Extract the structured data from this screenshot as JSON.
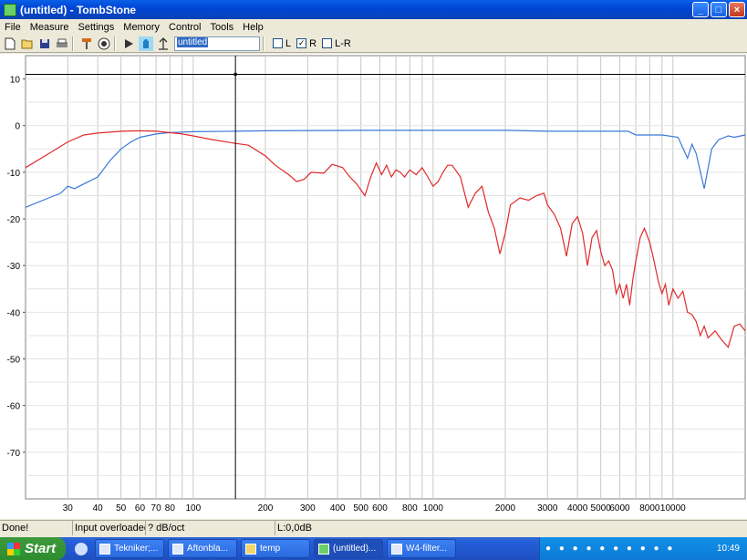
{
  "window": {
    "title": "(untitled) - TombStone"
  },
  "menu": [
    "File",
    "Measure",
    "Settings",
    "Memory",
    "Control",
    "Tools",
    "Help"
  ],
  "toolbar": {
    "name_value": "untitled",
    "checkboxes": [
      {
        "label": "L",
        "checked": false
      },
      {
        "label": "R",
        "checked": true
      },
      {
        "label": "L-R",
        "checked": false
      }
    ]
  },
  "chart_data": {
    "type": "line",
    "x_scale": "log",
    "xlim": [
      20,
      20000
    ],
    "ylim": [
      -80,
      15
    ],
    "x_ticks": [
      {
        "value": 30,
        "label": "30"
      },
      {
        "value": 40,
        "label": "40"
      },
      {
        "value": 50,
        "label": "50"
      },
      {
        "value": 60,
        "label": "60"
      },
      {
        "value": 70,
        "label": "70"
      },
      {
        "value": 80,
        "label": "80"
      },
      {
        "value": 100,
        "label": "100"
      },
      {
        "value": 200,
        "label": "200"
      },
      {
        "value": 300,
        "label": "300"
      },
      {
        "value": 400,
        "label": "400"
      },
      {
        "value": 500,
        "label": "500"
      },
      {
        "value": 600,
        "label": "600"
      },
      {
        "value": 800,
        "label": "800"
      },
      {
        "value": 1000,
        "label": "1000"
      },
      {
        "value": 2000,
        "label": "2000"
      },
      {
        "value": 3000,
        "label": "3000"
      },
      {
        "value": 4000,
        "label": "4000"
      },
      {
        "value": 5000,
        "label": "5000"
      },
      {
        "value": 6000,
        "label": "6000"
      },
      {
        "value": 8000,
        "label": "8000"
      },
      {
        "value": 10000,
        "label": "10000"
      }
    ],
    "y_ticks": [
      10,
      0,
      -10,
      -20,
      -30,
      -40,
      -50,
      -60,
      -70
    ],
    "grid": true,
    "cursor": {
      "x": 150,
      "y": 11
    },
    "series": [
      {
        "color": "#3a78d8",
        "points": [
          [
            20,
            -17.5
          ],
          [
            25,
            -15.5
          ],
          [
            28,
            -14.5
          ],
          [
            30,
            -13
          ],
          [
            32,
            -13.5
          ],
          [
            35,
            -12.5
          ],
          [
            40,
            -11
          ],
          [
            45,
            -7.5
          ],
          [
            50,
            -5
          ],
          [
            55,
            -3.5
          ],
          [
            60,
            -2.5
          ],
          [
            70,
            -1.8
          ],
          [
            80,
            -1.5
          ],
          [
            90,
            -1.4
          ],
          [
            100,
            -1.3
          ],
          [
            150,
            -1.2
          ],
          [
            200,
            -1.1
          ],
          [
            500,
            -1
          ],
          [
            1000,
            -1
          ],
          [
            2000,
            -1
          ],
          [
            3000,
            -1.2
          ],
          [
            5000,
            -1.2
          ],
          [
            6500,
            -1.2
          ],
          [
            7000,
            -2
          ],
          [
            9000,
            -2
          ],
          [
            10500,
            -2.5
          ],
          [
            11500,
            -7
          ],
          [
            12000,
            -4
          ],
          [
            12500,
            -6
          ],
          [
            13500,
            -13.5
          ],
          [
            14500,
            -5
          ],
          [
            15500,
            -3
          ],
          [
            17000,
            -2.2
          ],
          [
            18000,
            -2.5
          ],
          [
            20000,
            -2
          ]
        ]
      },
      {
        "color": "#e02a2a",
        "points": [
          [
            20,
            -9
          ],
          [
            25,
            -6
          ],
          [
            30,
            -3.5
          ],
          [
            35,
            -2
          ],
          [
            40,
            -1.6
          ],
          [
            50,
            -1.2
          ],
          [
            60,
            -1.1
          ],
          [
            70,
            -1.2
          ],
          [
            80,
            -1.5
          ],
          [
            90,
            -1.8
          ],
          [
            100,
            -2.2
          ],
          [
            120,
            -3
          ],
          [
            150,
            -3.8
          ],
          [
            170,
            -4.2
          ],
          [
            200,
            -6.5
          ],
          [
            220,
            -8.5
          ],
          [
            250,
            -10.5
          ],
          [
            270,
            -12
          ],
          [
            290,
            -11.5
          ],
          [
            310,
            -10
          ],
          [
            350,
            -10.2
          ],
          [
            380,
            -8.3
          ],
          [
            420,
            -9
          ],
          [
            450,
            -11
          ],
          [
            480,
            -12.5
          ],
          [
            520,
            -15
          ],
          [
            550,
            -11
          ],
          [
            580,
            -8
          ],
          [
            610,
            -10.5
          ],
          [
            640,
            -8.5
          ],
          [
            670,
            -11
          ],
          [
            700,
            -9.5
          ],
          [
            730,
            -10
          ],
          [
            760,
            -11
          ],
          [
            800,
            -9.5
          ],
          [
            850,
            -10.5
          ],
          [
            900,
            -9
          ],
          [
            950,
            -11
          ],
          [
            1000,
            -13
          ],
          [
            1050,
            -12
          ],
          [
            1100,
            -10
          ],
          [
            1150,
            -8.5
          ],
          [
            1200,
            -8.5
          ],
          [
            1300,
            -11
          ],
          [
            1400,
            -17.5
          ],
          [
            1500,
            -14.5
          ],
          [
            1600,
            -13
          ],
          [
            1700,
            -18.5
          ],
          [
            1800,
            -22
          ],
          [
            1900,
            -27.5
          ],
          [
            2000,
            -23
          ],
          [
            2100,
            -17
          ],
          [
            2300,
            -15.5
          ],
          [
            2500,
            -16
          ],
          [
            2700,
            -15
          ],
          [
            2900,
            -14.5
          ],
          [
            3000,
            -17
          ],
          [
            3200,
            -19
          ],
          [
            3400,
            -22
          ],
          [
            3600,
            -28
          ],
          [
            3800,
            -21
          ],
          [
            4000,
            -19.5
          ],
          [
            4200,
            -23
          ],
          [
            4400,
            -30
          ],
          [
            4600,
            -24
          ],
          [
            4800,
            -22.5
          ],
          [
            5000,
            -27
          ],
          [
            5200,
            -30
          ],
          [
            5400,
            -29
          ],
          [
            5600,
            -31
          ],
          [
            5800,
            -36
          ],
          [
            6000,
            -34
          ],
          [
            6200,
            -37
          ],
          [
            6400,
            -34
          ],
          [
            6600,
            -38.5
          ],
          [
            6800,
            -33
          ],
          [
            7000,
            -29
          ],
          [
            7300,
            -24
          ],
          [
            7600,
            -22
          ],
          [
            8000,
            -25
          ],
          [
            8300,
            -28.5
          ],
          [
            8700,
            -33.5
          ],
          [
            9000,
            -36
          ],
          [
            9300,
            -34
          ],
          [
            9600,
            -38.5
          ],
          [
            10000,
            -35
          ],
          [
            10500,
            -37
          ],
          [
            11000,
            -35.5
          ],
          [
            11500,
            -40
          ],
          [
            12000,
            -40.5
          ],
          [
            12500,
            -42
          ],
          [
            13000,
            -45
          ],
          [
            13500,
            -43
          ],
          [
            14000,
            -45.5
          ],
          [
            15000,
            -44
          ],
          [
            16000,
            -46
          ],
          [
            17000,
            -47.5
          ],
          [
            18000,
            -43
          ],
          [
            19000,
            -42.5
          ],
          [
            20000,
            -44
          ]
        ]
      }
    ]
  },
  "statusbar": {
    "message": "Done!",
    "warning": "Input overloaded!",
    "smoothing": "? dB/oct",
    "level": "L:0,0dB"
  },
  "taskbar": {
    "start_label": "Start",
    "tasks": [
      {
        "label": "Tekniker;...",
        "active": false
      },
      {
        "label": "Aftonbla...",
        "active": false
      },
      {
        "label": "temp",
        "active": false
      },
      {
        "label": "(untitled)...",
        "active": true
      },
      {
        "label": "W4-filter...",
        "active": false
      }
    ],
    "clock": "10:49"
  }
}
